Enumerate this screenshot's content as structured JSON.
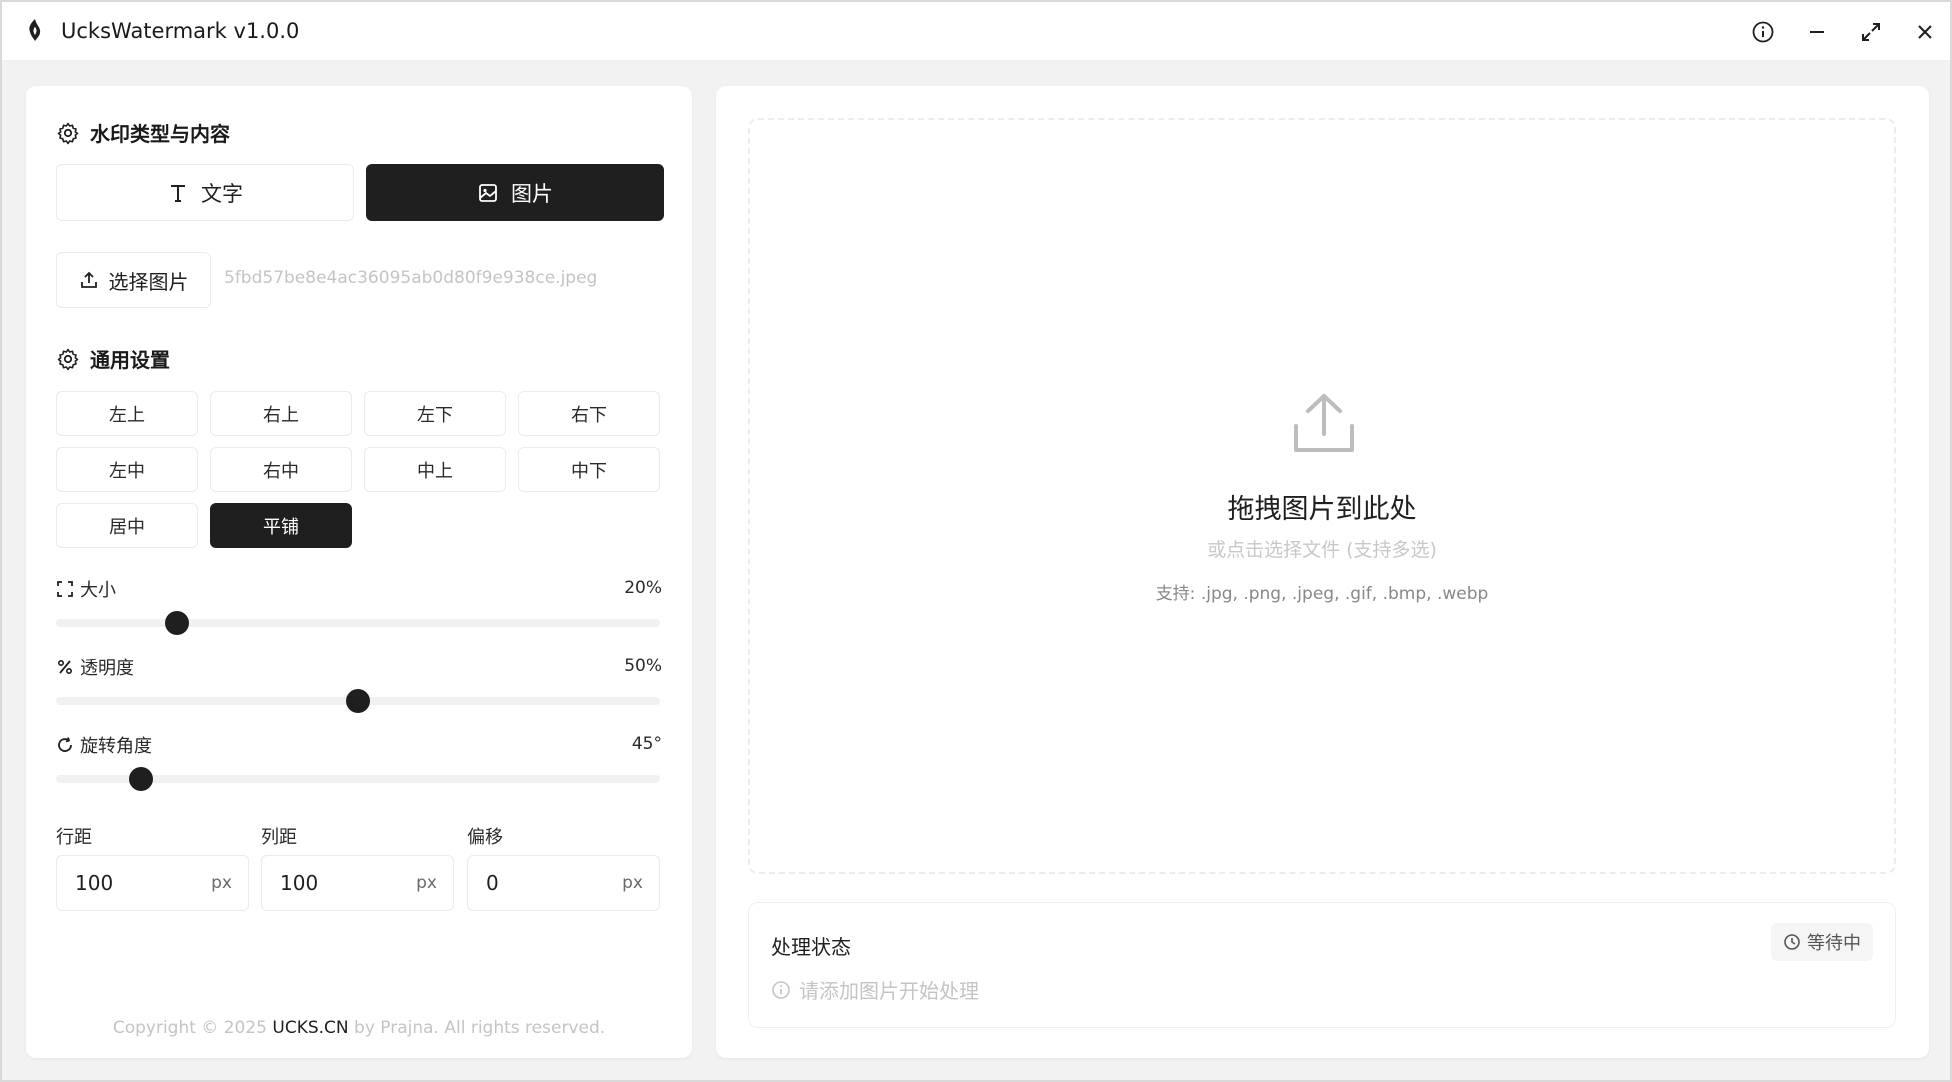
{
  "app": {
    "title": "UcksWatermark v1.0.0"
  },
  "window_controls": [
    "info-icon",
    "minimize-icon",
    "maximize-icon",
    "close-icon"
  ],
  "watermark_type": {
    "section_title": "水印类型与内容",
    "options": [
      {
        "label": "文字",
        "icon": "text-icon",
        "active": false
      },
      {
        "label": "图片",
        "icon": "image-icon",
        "active": true
      }
    ],
    "select_button": "选择图片",
    "file_name": "5fbd57be8e4ac36095ab0d80f9e938ce.jpeg"
  },
  "general": {
    "section_title": "通用设置",
    "positions": [
      {
        "label": "左上",
        "active": false
      },
      {
        "label": "右上",
        "active": false
      },
      {
        "label": "左下",
        "active": false
      },
      {
        "label": "右下",
        "active": false
      },
      {
        "label": "左中",
        "active": false
      },
      {
        "label": "右中",
        "active": false
      },
      {
        "label": "中上",
        "active": false
      },
      {
        "label": "中下",
        "active": false
      },
      {
        "label": "居中",
        "active": false
      },
      {
        "label": "平铺",
        "active": true
      }
    ],
    "sliders": {
      "size": {
        "label": "大小",
        "value_text": "20%",
        "level": 0.2
      },
      "opacity": {
        "label": "透明度",
        "value_text": "50%",
        "level": 0.5
      },
      "rotation": {
        "label": "旋转角度",
        "value_text": "45°",
        "level": 0.14
      }
    },
    "spacing": {
      "row": {
        "label": "行距",
        "value": "100",
        "unit": "px"
      },
      "col": {
        "label": "列距",
        "value": "100",
        "unit": "px"
      },
      "offset": {
        "label": "偏移",
        "value": "0",
        "unit": "px"
      }
    }
  },
  "footer": {
    "prefix": "Copyright © 2025 ",
    "brand": "UCKS.CN",
    "suffix": " by Prajna. All rights reserved."
  },
  "dropzone": {
    "title": "拖拽图片到此处",
    "subtitle": "或点击选择文件 (支持多选)",
    "formats": "支持: .jpg, .png, .jpeg, .gif, .bmp, .webp"
  },
  "status": {
    "title": "处理状态",
    "badge": "等待中",
    "message": "请添加图片开始处理"
  },
  "colors": {
    "accent": "#1f1f1f",
    "panel_bg": "#ffffff",
    "window_bg": "#f2f2f2"
  }
}
